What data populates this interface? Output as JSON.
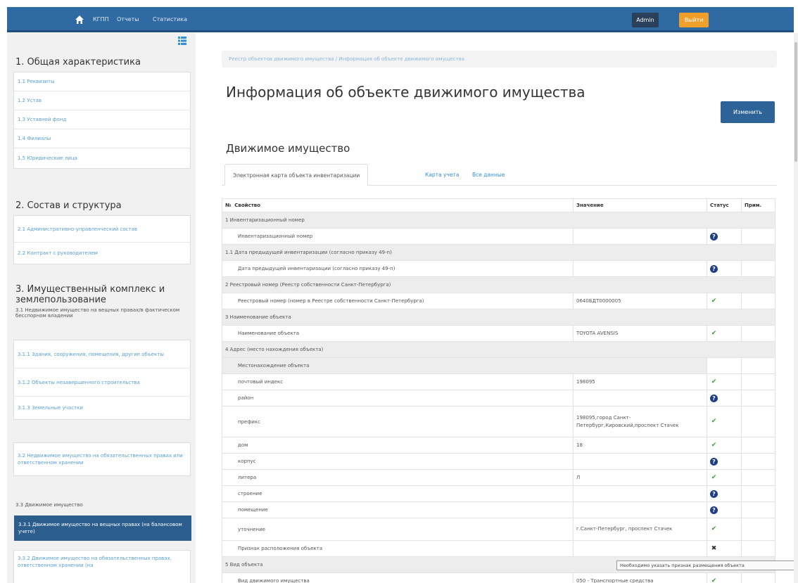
{
  "topbar": {
    "nav_items": [
      "КГПП",
      "Отчеты",
      "Статистика"
    ],
    "admin_label": "Admin",
    "logout_label": "Выйти"
  },
  "sidebar": {
    "section1_title": "1. Общая характеристика",
    "section1_items": [
      "1.1 Реквизиты",
      "1.2 Устав",
      "1.3 Уставной фонд",
      "1.4 Филиалы",
      "1.5 Юридические лица"
    ],
    "section2_title": "2. Состав и структура",
    "section2_items": [
      "2.1 Административно-управленческий состав",
      "2.2 Контракт с руководителем"
    ],
    "section3_title": "3. Имущественный комплекс и землепользование",
    "section3_sub1": "3.1 Недвижимое имущество на вещных правах/в фактическом бесспорном владении",
    "section3_items": [
      "3.1.1 Здания, сооружения, помещения, другие объекты",
      "3.1.2 Объекты незавершенного строительства",
      "3.1.3 Земельные участки"
    ],
    "section3_item2": "3.2 Недвижимое имущество на обязательственных правах или ответственном хранении",
    "section3_sub3": "3.3 Движимое имущество",
    "active_item": "3.3.1 Движимое имущество на вещных правах (на балансовом учете)",
    "section3_item4": "3.3.2 Движимое имущество на обязательственных правах, ответственном хранении (на"
  },
  "main": {
    "breadcrumb": "Реестр объектов движимого имущества / Информация об объекте движимого имущества",
    "title": "Информация об объекте движимого имущества",
    "edit_label": "Изменить",
    "subtitle": "Движимое имущество",
    "tabs": [
      "Электронная карта объекта инвентаризации",
      "Карта учета",
      "Все данные"
    ]
  },
  "table": {
    "headers": [
      "№",
      "Свойство",
      "Значение",
      "Статус",
      "Прим."
    ],
    "rows": [
      {
        "kind": "grp",
        "prop": "1 Инвентаризационный номер"
      },
      {
        "kind": "row",
        "prop": "Инвентаризационный номер",
        "value": "",
        "status": "q"
      },
      {
        "kind": "grp",
        "prop": "1.1 Дата предыдущей инвентаризации (согласно приказу 49-п)"
      },
      {
        "kind": "row",
        "prop": "Дата предыдущей инвентаризации (согласно приказу 49-п)",
        "value": "",
        "status": "q"
      },
      {
        "kind": "grp",
        "prop": "2 Реестровый номер (Реестр собственности Санкт-Петербурга)"
      },
      {
        "kind": "row",
        "prop": "Реестровый номер (номер в Реестре собственности Санкт-Петербурга)",
        "value": "0640БДТ0000005",
        "status": "ok"
      },
      {
        "kind": "grp",
        "prop": "3 Наименование объекта"
      },
      {
        "kind": "row",
        "prop": "Наименование объекта",
        "value": "TOYOTA AVENSIS",
        "status": "ok"
      },
      {
        "kind": "grp",
        "prop": "4 Адрес (место нахождения объекта)"
      },
      {
        "kind": "sub",
        "prop": "Местонахождение объекта"
      },
      {
        "kind": "row",
        "prop": "почтовый индекс",
        "value": "198095",
        "status": "ok"
      },
      {
        "kind": "row",
        "prop": "район",
        "value": "",
        "status": "q"
      },
      {
        "kind": "row",
        "prop": "префикс",
        "value": "198095,город Санкт-Петербург,Кировский,проспект Стачек",
        "status": "ok",
        "tall": 3
      },
      {
        "kind": "row",
        "prop": "дом",
        "value": "18",
        "status": "ok"
      },
      {
        "kind": "row",
        "prop": "корпус",
        "value": "",
        "status": "q"
      },
      {
        "kind": "row",
        "prop": "литера",
        "value": "Л",
        "status": "ok"
      },
      {
        "kind": "row",
        "prop": "строение",
        "value": "",
        "status": "q"
      },
      {
        "kind": "row",
        "prop": "помещение",
        "value": "",
        "status": "q"
      },
      {
        "kind": "row",
        "prop": "уточнение",
        "value": "г.Санкт-Петербург, проспект Стачек",
        "status": "ok",
        "tall": 2
      },
      {
        "kind": "row",
        "prop": "Признак расположения объекта",
        "value": "",
        "status": "x"
      },
      {
        "kind": "grp",
        "prop": "5 Вид объекта"
      },
      {
        "kind": "row",
        "prop": "Вид движимого имущества",
        "value": "050 - Транспортные средства",
        "status": "ok"
      }
    ]
  },
  "tooltip": "Необходимо указать признак размещения объекта"
}
